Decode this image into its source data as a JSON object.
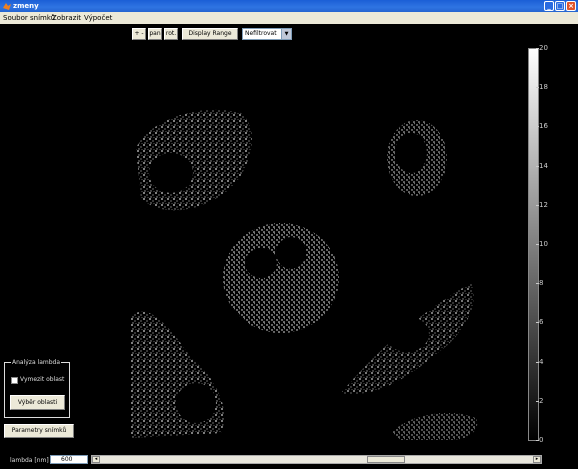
{
  "window": {
    "title": "zmeny"
  },
  "menu": {
    "items": [
      "Soubor snímků",
      "Zobrazit",
      "Výpočet"
    ]
  },
  "toolbar": {
    "zoom_label": "+ -",
    "pan_label": "pan",
    "rot_label": "rot.",
    "display_range_label": "Display Range",
    "filter_select_value": "Nefiltrovat"
  },
  "colorbar": {
    "ticks": [
      "20",
      "18",
      "16",
      "14",
      "12",
      "10",
      "8",
      "6",
      "4",
      "2",
      "0"
    ]
  },
  "analysis_panel": {
    "title": "Analýza lambda",
    "checkbox_label": "Vymezit oblast",
    "select_area_button": "Výběr oblasti"
  },
  "params_button": "Parametry snímků",
  "lambda": {
    "label": "lambda [nm]",
    "value": "600"
  }
}
